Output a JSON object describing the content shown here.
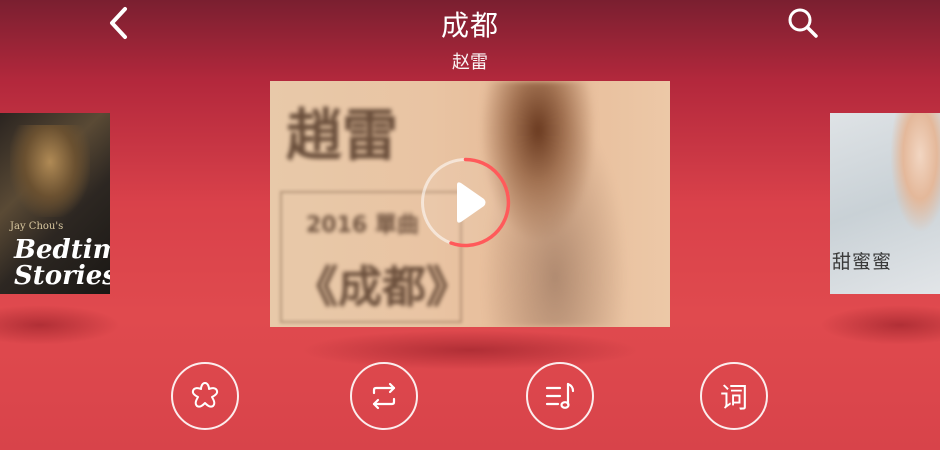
{
  "header": {
    "title": "成都",
    "artist": "赵雷"
  },
  "covers": {
    "left": {
      "brand": "Jay Chou's",
      "title": "Bedtime Stories"
    },
    "main": {
      "artist_text": "趙雷",
      "year_text": "2016 單曲",
      "title_text": "《成都》"
    },
    "right": {
      "title_text": "甜蜜蜜"
    }
  },
  "controls": {
    "lyric_label": "词"
  },
  "colors": {
    "background_top": "#7a1f30",
    "background_main": "#e04a4e",
    "progress_ring": "#ff5a5a",
    "foreground": "#ffffff"
  }
}
